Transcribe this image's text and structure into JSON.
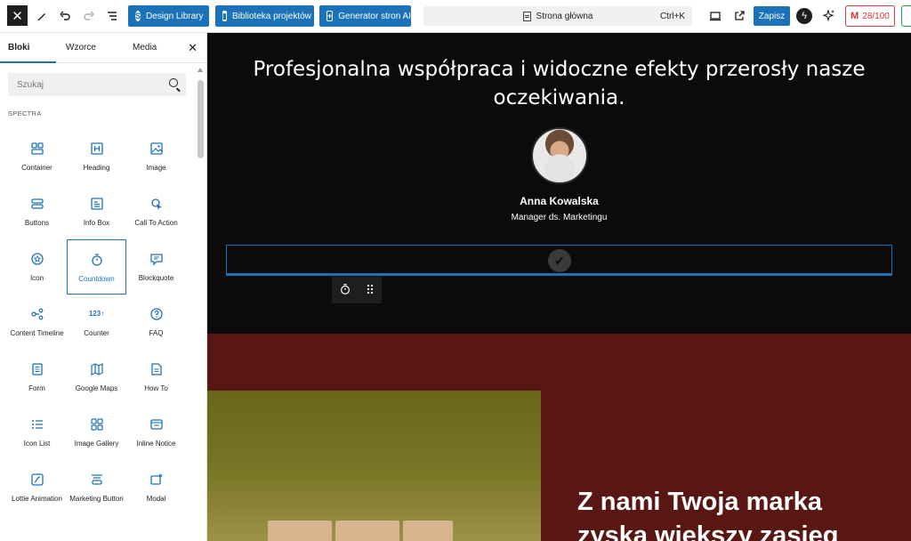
{
  "toolbar": {
    "close_label": "✕",
    "design_library": "Design Library",
    "projects_library": "Biblioteka projektów",
    "ai_generator": "Generator stron AI",
    "command_title": "Strona główna",
    "command_shortcut": "Ctrl+K",
    "save_label": "Zapisz",
    "score_label": "28/100",
    "icons": [
      "close-icon",
      "pen-icon",
      "undo-icon",
      "redo-icon",
      "list-view-icon",
      "desktop-preview-icon",
      "external-link-icon",
      "bolt-icon",
      "sparkle-icon"
    ]
  },
  "sidebar": {
    "tabs": [
      "Bloki",
      "Wzorce",
      "Media"
    ],
    "active_tab": "Bloki",
    "search_placeholder": "Szukaj",
    "section": "SPECTRA",
    "blocks": [
      {
        "label": "Container",
        "icon": "container-icon"
      },
      {
        "label": "Heading",
        "icon": "heading-icon"
      },
      {
        "label": "Image",
        "icon": "image-icon"
      },
      {
        "label": "Buttons",
        "icon": "buttons-icon"
      },
      {
        "label": "Info Box",
        "icon": "info-box-icon"
      },
      {
        "label": "Call To Action",
        "icon": "call-to-action-icon"
      },
      {
        "label": "Icon",
        "icon": "icon-block-icon"
      },
      {
        "label": "Countdown",
        "icon": "countdown-icon",
        "selected": true
      },
      {
        "label": "Blockquote",
        "icon": "blockquote-icon"
      },
      {
        "label": "Content Timeline",
        "icon": "timeline-icon"
      },
      {
        "label": "Counter",
        "icon": "counter-icon"
      },
      {
        "label": "FAQ",
        "icon": "faq-icon"
      },
      {
        "label": "Form",
        "icon": "form-icon"
      },
      {
        "label": "Google Maps",
        "icon": "map-icon"
      },
      {
        "label": "How To",
        "icon": "how-to-icon"
      },
      {
        "label": "Icon List",
        "icon": "icon-list-icon"
      },
      {
        "label": "Image Gallery",
        "icon": "gallery-icon"
      },
      {
        "label": "Inline Notice",
        "icon": "inline-notice-icon"
      },
      {
        "label": "Lottie Animation",
        "icon": "lottie-icon"
      },
      {
        "label": "Marketing Button",
        "icon": "marketing-button-icon"
      },
      {
        "label": "Modal",
        "icon": "modal-icon"
      }
    ]
  },
  "canvas": {
    "quote": "Profesjonalna współpraca i widoczne efekty przerosły nasze oczekiwania.",
    "author_name": "Anna Kowalska",
    "author_role": "Manager ds. Marketingu",
    "headline": "Z nami Twoja marka zyska większy zasięg",
    "block_toolbar_icons": [
      "countdown-icon",
      "drag-handle-icon"
    ]
  },
  "colors": {
    "accent": "#1b72b8",
    "dark_section": "#0b0b0b",
    "red_section": "#581712",
    "score": "#d63638"
  }
}
